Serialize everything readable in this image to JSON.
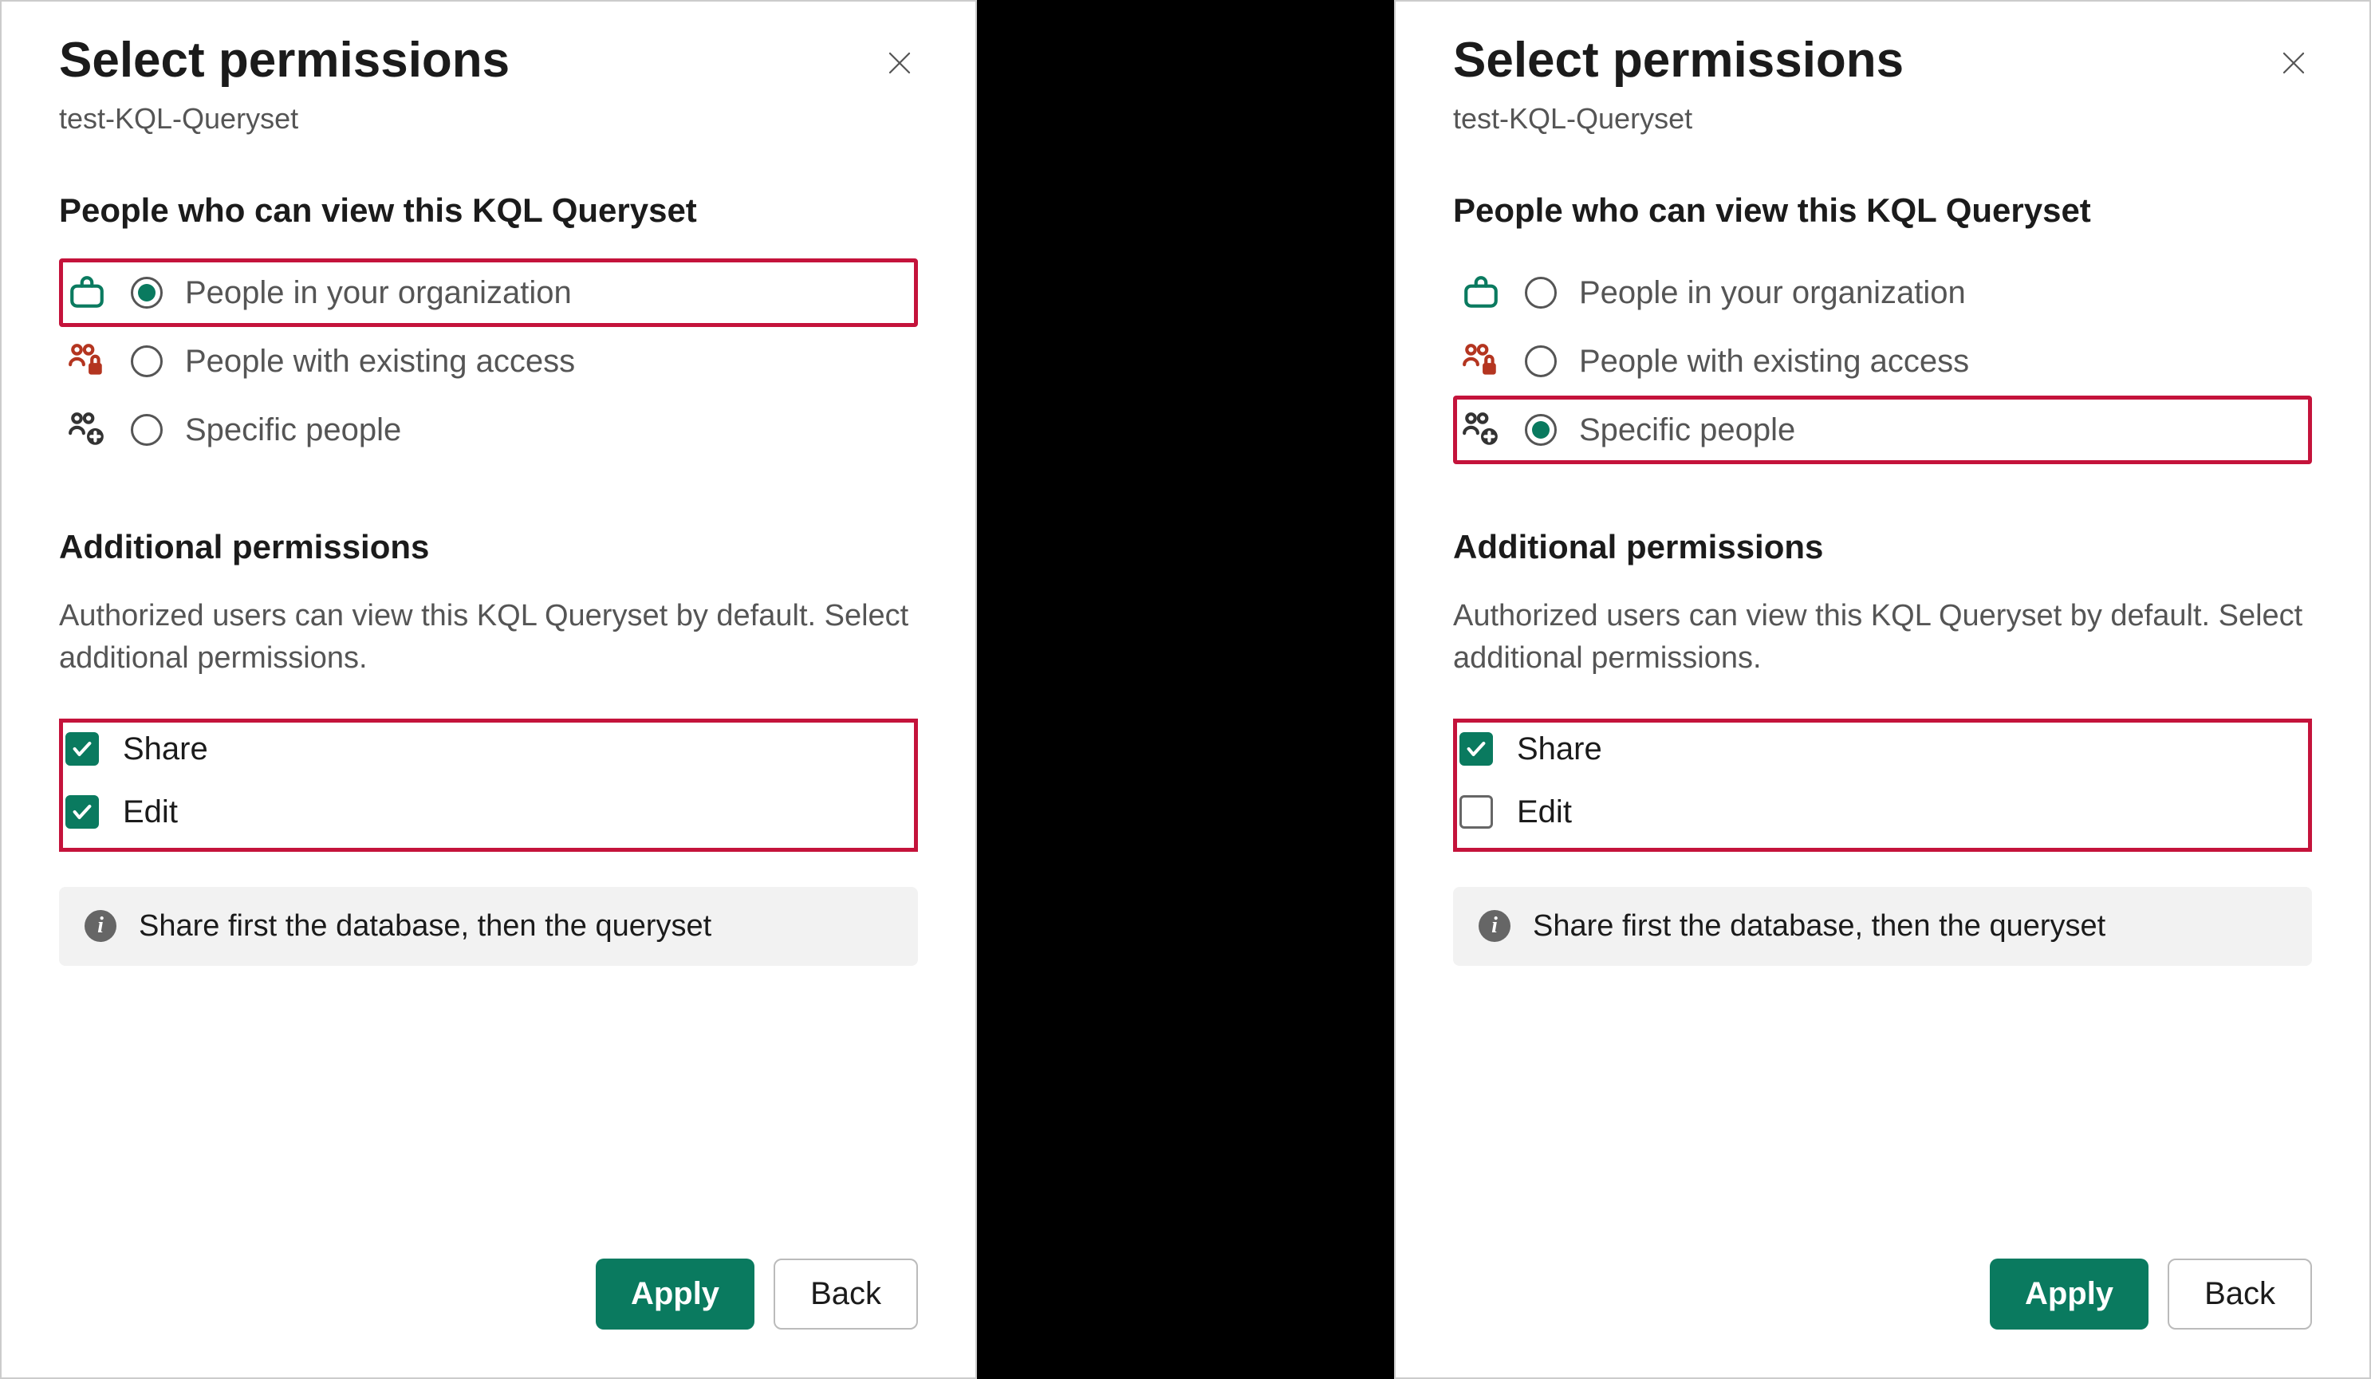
{
  "panels": [
    {
      "title": "Select permissions",
      "subtitle": "test-KQL-Queryset",
      "viewSection": "People who can view this KQL Queryset",
      "options": [
        {
          "label": "People in your organization",
          "selected": true,
          "highlighted": true,
          "icon": "briefcase",
          "iconColor": "#0a7a5f"
        },
        {
          "label": "People with existing access",
          "selected": false,
          "highlighted": false,
          "icon": "people-lock",
          "iconColor": "#b43520"
        },
        {
          "label": "Specific people",
          "selected": false,
          "highlighted": false,
          "icon": "people-add",
          "iconColor": "#333"
        }
      ],
      "additionalTitle": "Additional permissions",
      "additionalDesc": "Authorized users can view this KQL Queryset by default. Select additional permissions.",
      "checkboxesHighlighted": true,
      "checkboxes": [
        {
          "label": "Share",
          "checked": true
        },
        {
          "label": "Edit",
          "checked": true
        }
      ],
      "infoText": "Share first the database, then the queryset",
      "applyLabel": "Apply",
      "backLabel": "Back"
    },
    {
      "title": "Select permissions",
      "subtitle": "test-KQL-Queryset",
      "viewSection": "People who can view this KQL Queryset",
      "options": [
        {
          "label": "People in your organization",
          "selected": false,
          "highlighted": false,
          "icon": "briefcase",
          "iconColor": "#0a7a5f"
        },
        {
          "label": "People with existing access",
          "selected": false,
          "highlighted": false,
          "icon": "people-lock",
          "iconColor": "#b43520"
        },
        {
          "label": "Specific people",
          "selected": true,
          "highlighted": true,
          "icon": "people-add",
          "iconColor": "#333"
        }
      ],
      "additionalTitle": "Additional permissions",
      "additionalDesc": "Authorized users can view this KQL Queryset by default. Select additional permissions.",
      "checkboxesHighlighted": true,
      "checkboxes": [
        {
          "label": "Share",
          "checked": true
        },
        {
          "label": "Edit",
          "checked": false
        }
      ],
      "infoText": "Share first the database, then the queryset",
      "applyLabel": "Apply",
      "backLabel": "Back"
    }
  ]
}
